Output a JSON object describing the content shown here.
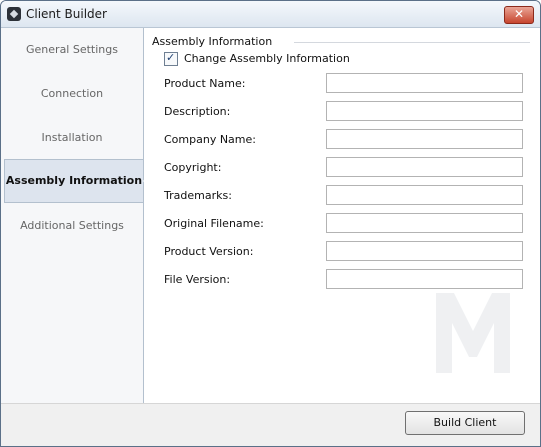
{
  "window": {
    "title": "Client Builder"
  },
  "sidebar": {
    "items": [
      {
        "label": "General Settings"
      },
      {
        "label": "Connection"
      },
      {
        "label": "Installation"
      },
      {
        "label": "Assembly Information"
      },
      {
        "label": "Additional Settings"
      }
    ]
  },
  "assembly": {
    "group_title": "Assembly Information",
    "checkbox_label": "Change Assembly Information",
    "fields": [
      {
        "label": "Product Name:",
        "value": ""
      },
      {
        "label": "Description:",
        "value": ""
      },
      {
        "label": "Company Name:",
        "value": ""
      },
      {
        "label": "Copyright:",
        "value": ""
      },
      {
        "label": "Trademarks:",
        "value": ""
      },
      {
        "label": "Original Filename:",
        "value": ""
      },
      {
        "label": "Product Version:",
        "value": ""
      },
      {
        "label": "File Version:",
        "value": ""
      }
    ]
  },
  "footer": {
    "build_label": "Build Client"
  }
}
